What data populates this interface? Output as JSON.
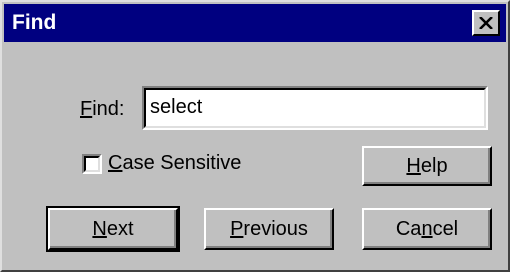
{
  "window": {
    "title": "Find",
    "close_glyph": "✕"
  },
  "find_field": {
    "label_mnemonic": "F",
    "label_rest": "ind:",
    "value": "select"
  },
  "case_sensitive": {
    "label_mnemonic": "C",
    "label_rest": "ase Sensitive",
    "checked": false
  },
  "buttons": {
    "help": {
      "mnemonic": "H",
      "rest": "elp"
    },
    "next": {
      "mnemonic": "N",
      "rest": "ext"
    },
    "previous": {
      "mnemonic": "P",
      "rest": "revious"
    },
    "cancel": {
      "before": "Ca",
      "mnemonic": "n",
      "rest": "cel"
    }
  },
  "colors": {
    "titlebar": "#000080",
    "dialog_face": "#c0c0c0"
  }
}
